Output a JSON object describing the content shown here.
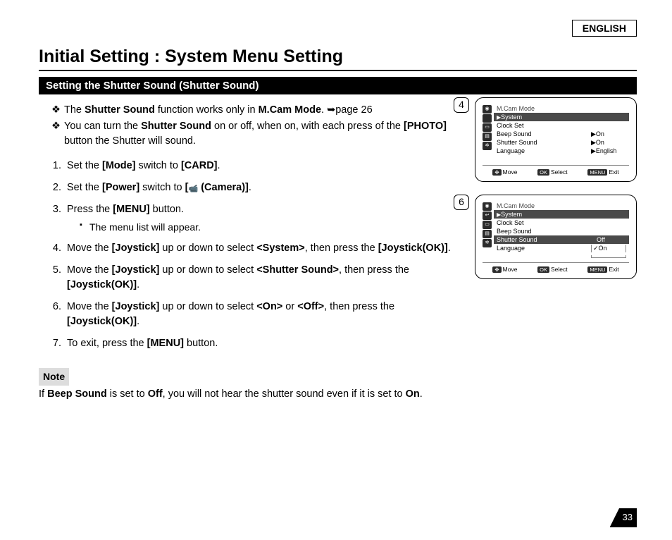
{
  "language_tag": "ENGLISH",
  "title": "Initial Setting : System Menu Setting",
  "section": "Setting the Shutter Sound (Shutter Sound)",
  "intro1_a": "The ",
  "intro1_b": "Shutter Sound",
  "intro1_c": " function works only in ",
  "intro1_d": "M.Cam Mode",
  "intro1_e": ". ➥page 26",
  "intro2_a": "You can turn the ",
  "intro2_b": "Shutter Sound",
  "intro2_c": " on or off, when on, with each press of the ",
  "intro2_d": "[PHOTO]",
  "intro2_e": " button the Shutter will sound.",
  "steps": {
    "s1_a": "Set the ",
    "s1_b": "[Mode]",
    "s1_c": " switch to ",
    "s1_d": "[CARD]",
    "s1_e": ".",
    "s2_a": "Set the ",
    "s2_b": "[Power]",
    "s2_c": " switch to ",
    "s2_d": "[",
    "s2_e": " (Camera)]",
    "s2_f": ".",
    "s3_a": "Press the ",
    "s3_b": "[MENU]",
    "s3_c": " button.",
    "s3_sub": "The menu list will appear.",
    "s4_a": "Move the ",
    "s4_b": "[Joystick]",
    "s4_c": " up or down to select ",
    "s4_d": "<System>",
    "s4_e": ", then press the ",
    "s4_f": "[Joystick(OK)]",
    "s4_g": ".",
    "s5_a": "Move the ",
    "s5_b": "[Joystick]",
    "s5_c": " up or down to select ",
    "s5_d": "<Shutter Sound>",
    "s5_e": ", then press the ",
    "s5_f": "[Joystick(OK)]",
    "s5_g": ".",
    "s6_a": "Move the ",
    "s6_b": "[Joystick]",
    "s6_c": " up or down to select ",
    "s6_d": "<On>",
    "s6_e": " or ",
    "s6_f": "<Off>",
    "s6_g": ", then press the ",
    "s6_h": "[Joystick(OK)]",
    "s6_i": ".",
    "s7_a": "To exit, press the ",
    "s7_b": "[MENU]",
    "s7_c": " button."
  },
  "note_label": "Note",
  "note_a": "If ",
  "note_b": "Beep Sound",
  "note_c": " is set to ",
  "note_d": "Off",
  "note_e": ", you will not hear the shutter sound even if it is set to ",
  "note_f": "On",
  "note_g": ".",
  "fig4": {
    "num": "4",
    "title": "M.Cam Mode",
    "rows": [
      {
        "lbl": "System",
        "val": "",
        "hl": true,
        "arrow": true
      },
      {
        "lbl": "Clock Set",
        "val": ""
      },
      {
        "lbl": "Beep Sound",
        "val": "▶On"
      },
      {
        "lbl": "Shutter Sound",
        "val": "▶On"
      },
      {
        "lbl": "Language",
        "val": "▶English"
      }
    ],
    "bar": {
      "move": "Move",
      "select": "Select",
      "exit": "Exit"
    }
  },
  "fig6": {
    "num": "6",
    "title": "M.Cam Mode",
    "back": "System",
    "rows": [
      {
        "lbl": "Clock Set"
      },
      {
        "lbl": "Beep Sound"
      },
      {
        "lbl": "Shutter Sound",
        "hl": true
      },
      {
        "lbl": "Language"
      }
    ],
    "options": [
      {
        "lbl": "Off",
        "hl": true
      },
      {
        "lbl": "On",
        "check": true
      }
    ],
    "bar": {
      "move": "Move",
      "select": "Select",
      "exit": "Exit"
    }
  },
  "bar_keys": {
    "move": "✥",
    "ok": "OK",
    "menu": "MENU"
  },
  "page_num": "33"
}
